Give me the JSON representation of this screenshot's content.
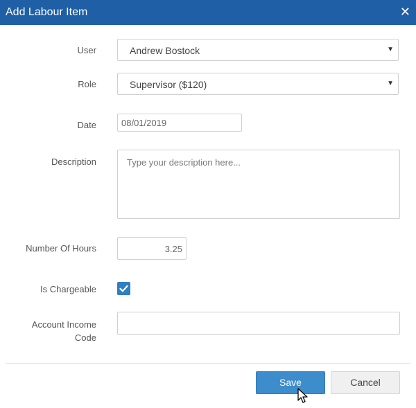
{
  "dialog": {
    "title": "Add Labour Item"
  },
  "form": {
    "user": {
      "label": "User",
      "value": "Andrew Bostock"
    },
    "role": {
      "label": "Role",
      "value": "Supervisor ($120)"
    },
    "date": {
      "label": "Date",
      "value": "08/01/2019"
    },
    "description": {
      "label": "Description",
      "placeholder": "Type your description here..."
    },
    "hours": {
      "label": "Number Of Hours",
      "value": "3.25"
    },
    "chargeable": {
      "label": "Is Chargeable",
      "checked": true
    },
    "income_code": {
      "label_line1": "Account Income",
      "label_line2": "Code",
      "value": ""
    }
  },
  "footer": {
    "save_label": "Save",
    "cancel_label": "Cancel"
  },
  "icons": {
    "close": "close-icon",
    "caret": "caret-down-icon",
    "check": "check-icon",
    "cursor": "pointer-cursor-icon"
  },
  "colors": {
    "titlebar": "#1f5fa6",
    "primary_button": "#3d8ccc",
    "checkbox": "#2f7fc1"
  }
}
